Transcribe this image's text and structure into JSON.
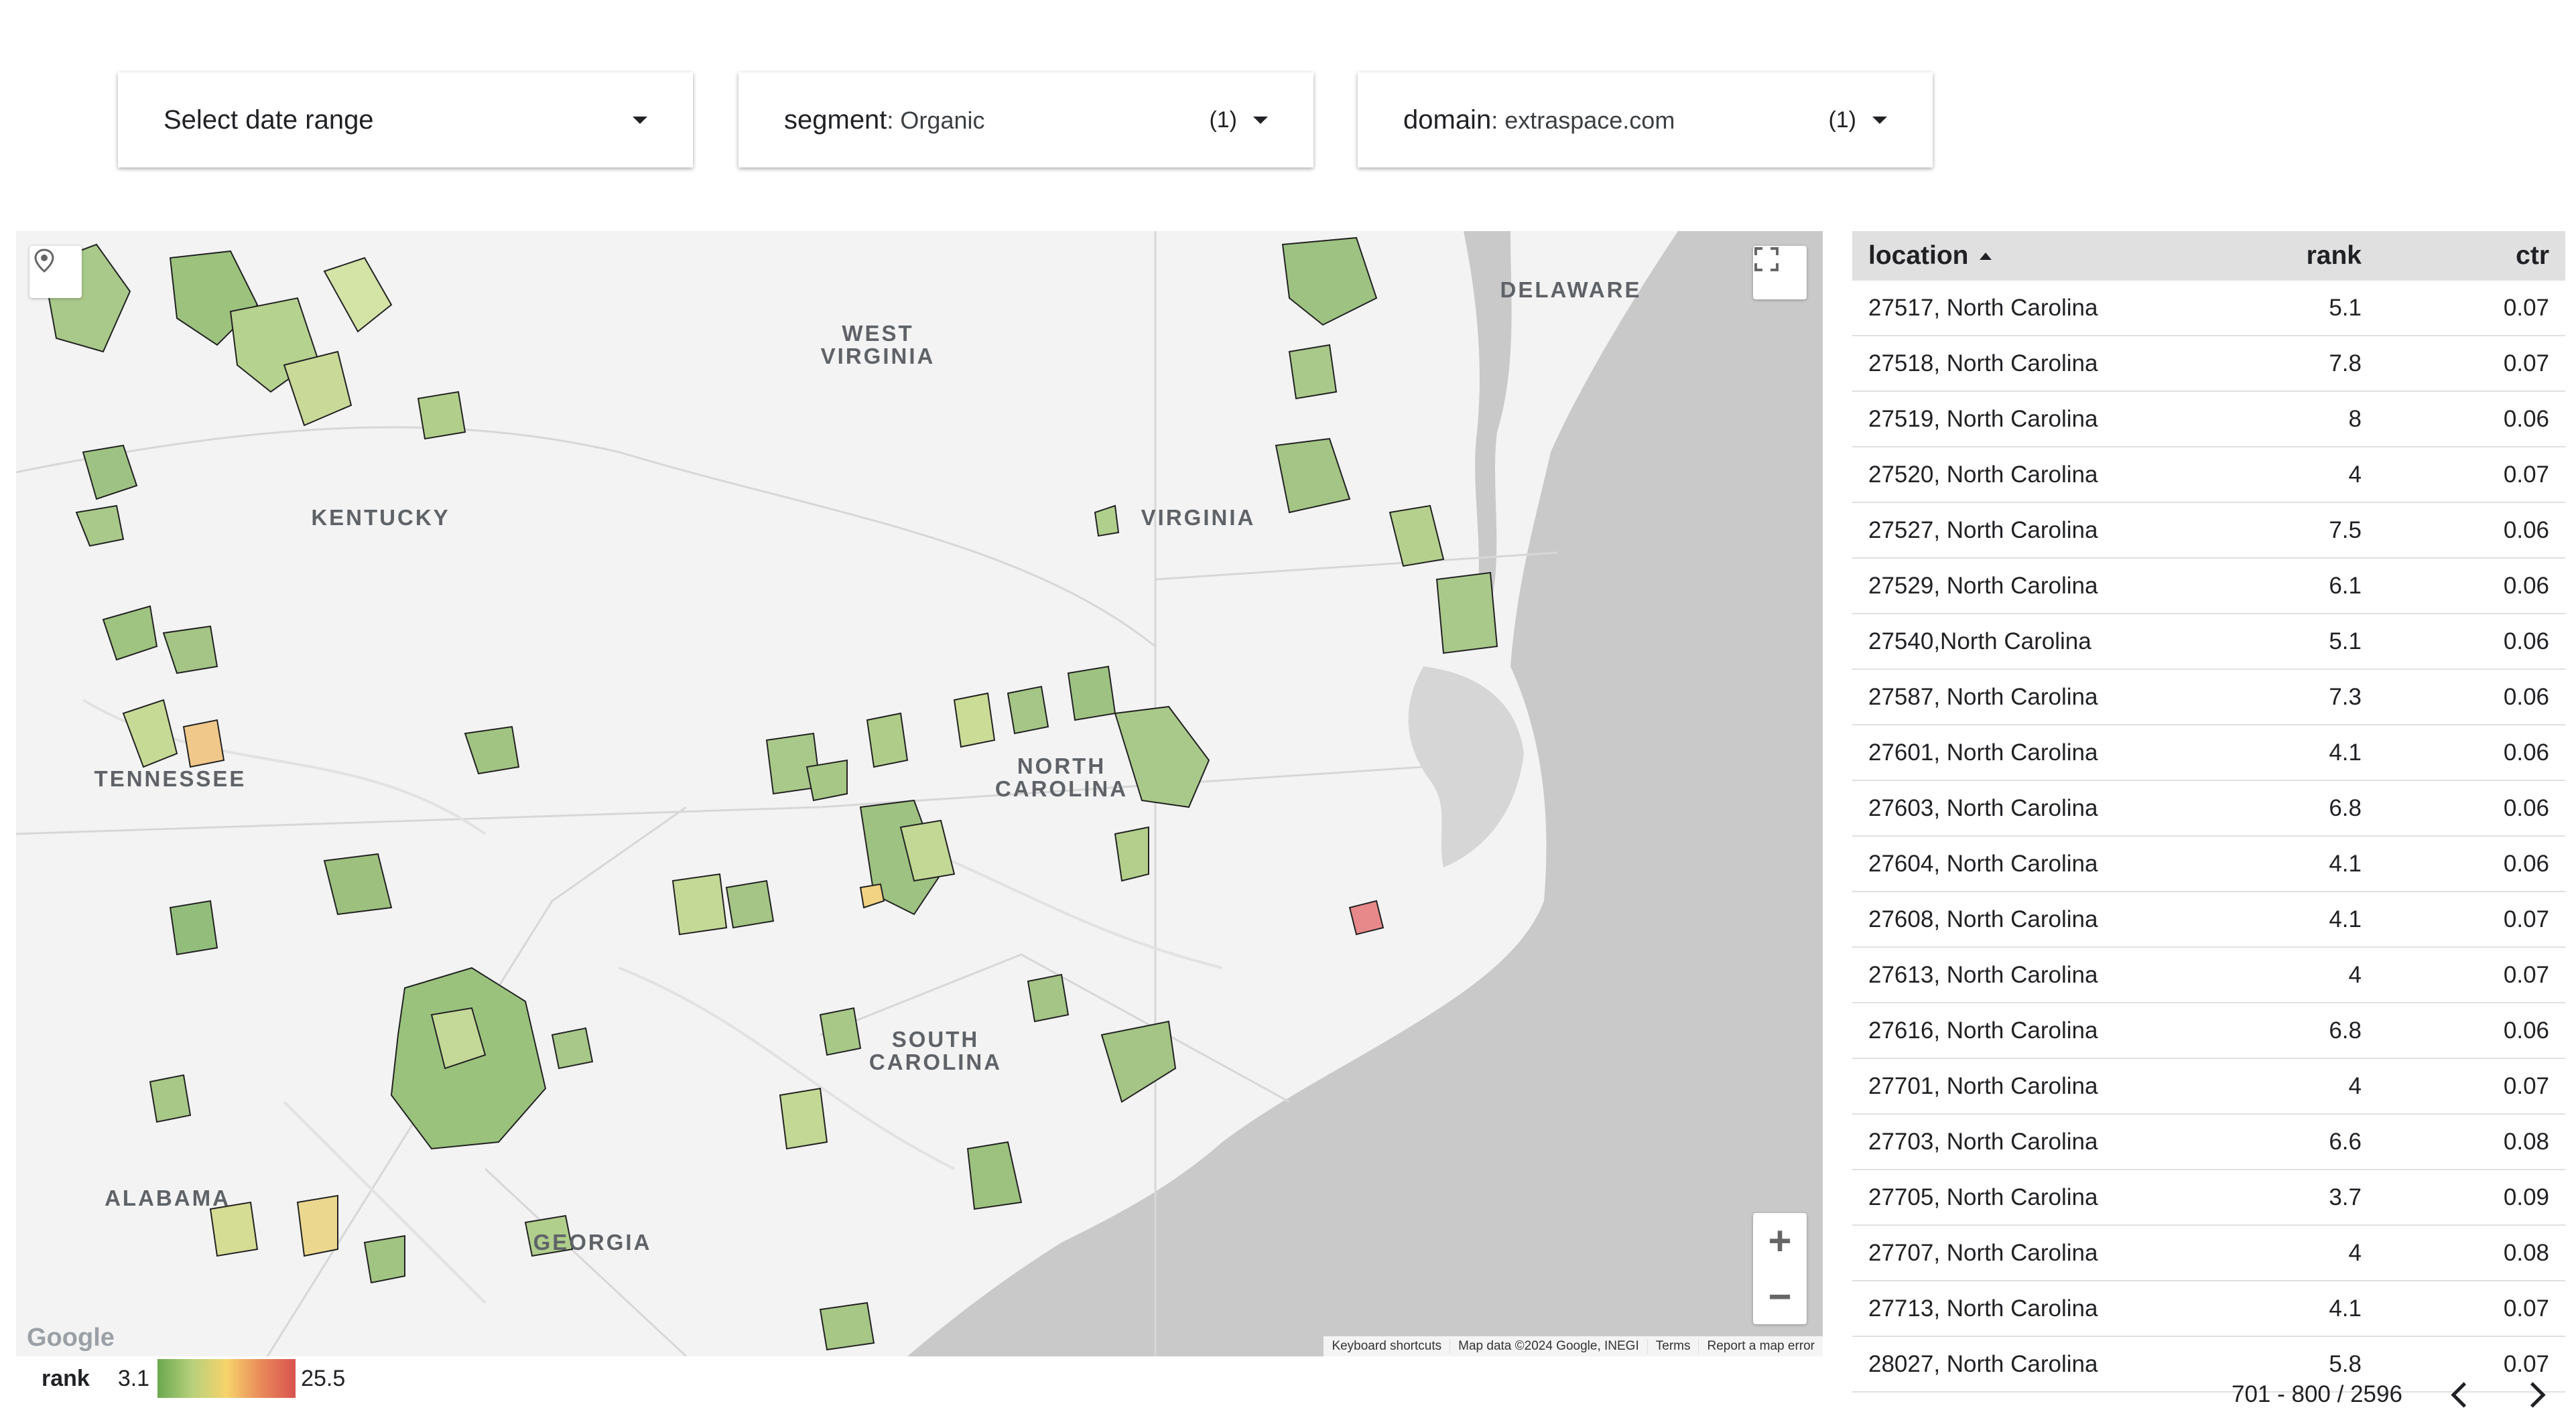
{
  "filters": [
    {
      "label": "Select date range",
      "value": "",
      "count": ""
    },
    {
      "label": "segment",
      "value": ": Organic",
      "count": "(1)"
    },
    {
      "label": "domain",
      "value": ": extraspace.com",
      "count": "(1)"
    }
  ],
  "map": {
    "states": [
      "WEST\nVIRGINIA",
      "KENTUCKY",
      "VIRGINIA",
      "DELAWARE",
      "TENNESSEE",
      "NORTH\nCAROLINA",
      "SOUTH\nCAROLINA",
      "ALABAMA",
      "GEORGIA"
    ],
    "attribution": [
      "Keyboard shortcuts",
      "Map data ©2024 Google, INEGI",
      "Terms",
      "Report a map error"
    ],
    "logo": "Google",
    "zoom_in": "+",
    "zoom_out": "−"
  },
  "legend": {
    "title": "rank",
    "min": "3.1",
    "max": "25.5",
    "colors": [
      "#6aa84f",
      "#b7d07c",
      "#f6d36b",
      "#e98a5a",
      "#d9534f"
    ]
  },
  "table": {
    "headers": {
      "location": "location",
      "rank": "rank",
      "ctr": "ctr"
    },
    "rows": [
      [
        "27517, North Carolina",
        "5.1",
        "0.07"
      ],
      [
        "27518, North Carolina",
        "7.8",
        "0.07"
      ],
      [
        "27519, North Carolina",
        "8",
        "0.06"
      ],
      [
        "27520, North Carolina",
        "4",
        "0.07"
      ],
      [
        "27527, North Carolina",
        "7.5",
        "0.06"
      ],
      [
        "27529, North Carolina",
        "6.1",
        "0.06"
      ],
      [
        "27540,North Carolina",
        "5.1",
        "0.06"
      ],
      [
        "27587, North Carolina",
        "7.3",
        "0.06"
      ],
      [
        "27601, North Carolina",
        "4.1",
        "0.06"
      ],
      [
        "27603, North Carolina",
        "6.8",
        "0.06"
      ],
      [
        "27604, North Carolina",
        "4.1",
        "0.06"
      ],
      [
        "27608, North Carolina",
        "4.1",
        "0.07"
      ],
      [
        "27613, North Carolina",
        "4",
        "0.07"
      ],
      [
        "27616, North Carolina",
        "6.8",
        "0.06"
      ],
      [
        "27701, North Carolina",
        "4",
        "0.07"
      ],
      [
        "27703, North Carolina",
        "6.6",
        "0.08"
      ],
      [
        "27705, North Carolina",
        "3.7",
        "0.09"
      ],
      [
        "27707, North Carolina",
        "4",
        "0.08"
      ],
      [
        "27713, North Carolina",
        "4.1",
        "0.07"
      ],
      [
        "28027, North Carolina",
        "5.8",
        "0.07"
      ]
    ]
  },
  "pager": {
    "text": "701 - 800 / 2596"
  }
}
